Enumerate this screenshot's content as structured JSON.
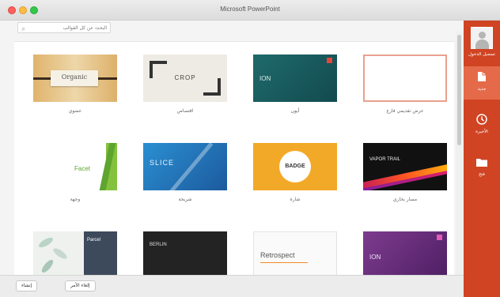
{
  "window": {
    "title": "Microsoft PowerPoint"
  },
  "search": {
    "placeholder": "البحث عن كل القوالب"
  },
  "templates": [
    {
      "name": "عضوي",
      "thumb_text": "Organic"
    },
    {
      "name": "اقتصاص",
      "thumb_text": "CROP"
    },
    {
      "name": "أيون",
      "thumb_text": "ION"
    },
    {
      "name": "عرض تقديمي فارغ",
      "thumb_text": ""
    },
    {
      "name": "وجهة",
      "thumb_text": "Facet"
    },
    {
      "name": "شريحة",
      "thumb_text": "SLICE"
    },
    {
      "name": "شارة",
      "thumb_text": "BADGE"
    },
    {
      "name": "مسار بخاري",
      "thumb_text": "VAPOR TRAIL"
    },
    {
      "name": "",
      "thumb_text": "Parcel"
    },
    {
      "name": "",
      "thumb_text": "BERLIN"
    },
    {
      "name": "",
      "thumb_text": "Retrospect"
    },
    {
      "name": "",
      "thumb_text": "ION"
    }
  ],
  "sidebar": {
    "signin_label": "تسجيل الدخول",
    "nav": [
      {
        "label": "جديد",
        "icon": "new-document-icon"
      },
      {
        "label": "الأخيرة",
        "icon": "clock-icon"
      },
      {
        "label": "فتح",
        "icon": "folder-icon"
      }
    ]
  },
  "footer": {
    "cancel_label": "إلغاء الأمر",
    "create_label": "إنشاء"
  },
  "colors": {
    "sidebar": "#d04423",
    "sidebar_active": "#e56a4a"
  }
}
